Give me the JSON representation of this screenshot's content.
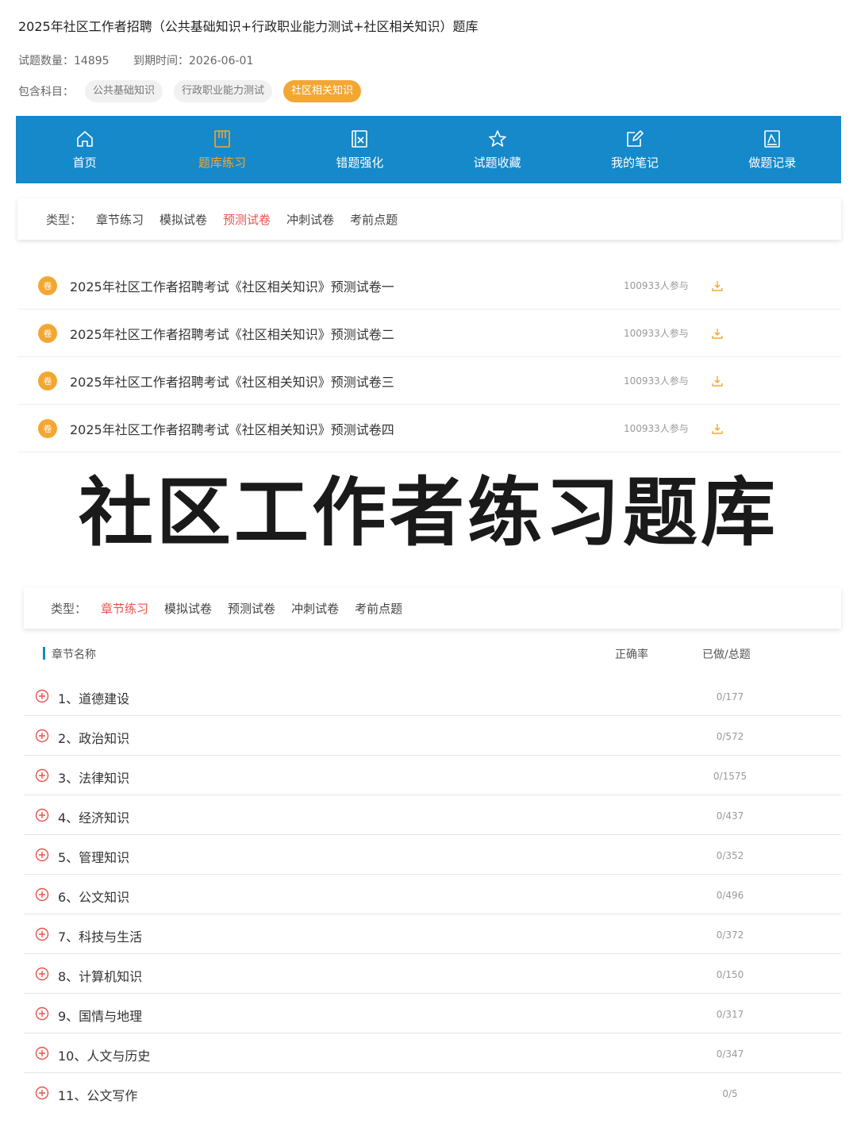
{
  "header": {
    "title": "2025年社区工作者招聘（公共基础知识+行政职业能力测试+社区相关知识）题库",
    "count_text": "试题数量：14895",
    "expire_text": "到期时间：2026-06-01",
    "subjects_label": "包含科目：",
    "subjects": [
      "公共基础知识",
      "行政职业能力测试",
      "社区相关知识"
    ]
  },
  "nav": {
    "items": [
      {
        "label": "首页",
        "icon": "home-icon"
      },
      {
        "label": "题库练习",
        "icon": "book-icon"
      },
      {
        "label": "错题强化",
        "icon": "wrong-question-icon"
      },
      {
        "label": "试题收藏",
        "icon": "star-icon"
      },
      {
        "label": "我的笔记",
        "icon": "edit-note-icon"
      },
      {
        "label": "做题记录",
        "icon": "record-icon"
      }
    ],
    "active_index": 1,
    "bg_color": "#1589c9",
    "active_color": "#f3a733"
  },
  "filter_top": {
    "type_label": "类型：",
    "items": [
      "章节练习",
      "模拟试卷",
      "预测试卷",
      "冲刺试卷",
      "考前点题"
    ],
    "active_index": 2
  },
  "papers": [
    {
      "badge": "卷",
      "title": "2025年社区工作者招聘考试《社区相关知识》预测试卷一",
      "count": "100933人参与"
    },
    {
      "badge": "卷",
      "title": "2025年社区工作者招聘考试《社区相关知识》预测试卷二",
      "count": "100933人参与"
    },
    {
      "badge": "卷",
      "title": "2025年社区工作者招聘考试《社区相关知识》预测试卷三",
      "count": "100933人参与"
    },
    {
      "badge": "卷",
      "title": "2025年社区工作者招聘考试《社区相关知识》预测试卷四",
      "count": "100933人参与"
    }
  ],
  "banner": {
    "text": "社区工作者练习题库"
  },
  "filter_bottom": {
    "type_label": "类型：",
    "items": [
      "章节练习",
      "模拟试卷",
      "预测试卷",
      "冲刺试卷",
      "考前点题"
    ],
    "active_index": 0
  },
  "chapters": {
    "col_name": "章节名称",
    "col_rate": "正确率",
    "col_done": "已做/总题",
    "rows": [
      {
        "name": "1、道德建设",
        "progress": "0/177"
      },
      {
        "name": "2、政治知识",
        "progress": "0/572"
      },
      {
        "name": "3、法律知识",
        "progress": "0/1575"
      },
      {
        "name": "4、经济知识",
        "progress": "0/437"
      },
      {
        "name": "5、管理知识",
        "progress": "0/352"
      },
      {
        "name": "6、公文知识",
        "progress": "0/496"
      },
      {
        "name": "7、科技与生活",
        "progress": "0/372"
      },
      {
        "name": "8、计算机知识",
        "progress": "0/150"
      },
      {
        "name": "9、国情与地理",
        "progress": "0/317"
      },
      {
        "name": "10、人文与历史",
        "progress": "0/347"
      },
      {
        "name": "11、公文写作",
        "progress": "0/5"
      }
    ]
  },
  "colors": {
    "accent_orange": "#f3a733",
    "accent_red": "#e8534b",
    "nav_blue": "#1589c9"
  }
}
